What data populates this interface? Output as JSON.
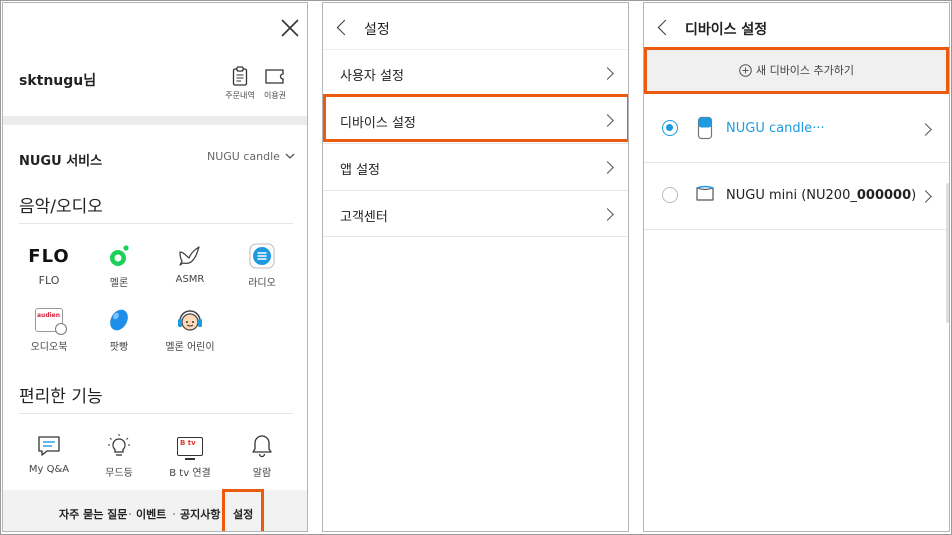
{
  "panel1": {
    "username": "sktnugu님",
    "header_actions": [
      {
        "label": "주문내역",
        "icon": "clipboard-icon"
      },
      {
        "label": "이용권",
        "icon": "ticket-icon"
      }
    ],
    "service_title": "NUGU 서비스",
    "device_selector": "NUGU candle",
    "music_section_title": "음악/오디오",
    "music_items": [
      {
        "label": "FLO",
        "logo": "FLO",
        "icon": "flo-logo-icon"
      },
      {
        "label": "멜론",
        "icon": "melon-icon"
      },
      {
        "label": "ASMR",
        "icon": "bird-icon"
      },
      {
        "label": "라디오",
        "icon": "radio-icon"
      },
      {
        "label": "오디오북",
        "icon": "audiobook-icon"
      },
      {
        "label": "팟빵",
        "icon": "podbbang-icon"
      },
      {
        "label": "멜론 어린이",
        "icon": "melon-kids-icon"
      }
    ],
    "audiobook_logo_text": "audien",
    "tools_section_title": "편리한 기능",
    "tool_items": [
      {
        "label": "My Q&A",
        "icon": "chat-icon"
      },
      {
        "label": "무드등",
        "icon": "bulb-icon"
      },
      {
        "label": "B tv 연결",
        "icon": "tv-icon",
        "badge": "B tv"
      },
      {
        "label": "알람",
        "icon": "bell-icon"
      }
    ],
    "footer_links": [
      "자주 묻는 질문",
      "이벤트",
      "공지사항",
      "설정"
    ]
  },
  "panel2": {
    "title": "설정",
    "menu": [
      "사용자 설정",
      "디바이스 설정",
      "앱 설정",
      "고객센터"
    ]
  },
  "panel3": {
    "title": "디바이스 설정",
    "add_button": "새 디바이스 추가하기",
    "devices": [
      {
        "name": "NUGU candle···",
        "selected": true
      },
      {
        "name_prefix": "NUGU mini (NU200_",
        "name_bold": "000000",
        "name_suffix": ")",
        "selected": false
      }
    ]
  },
  "colors": {
    "highlight": "#ea5b10",
    "accent_blue": "#1e9be0",
    "melon_green": "#1cd05a"
  }
}
